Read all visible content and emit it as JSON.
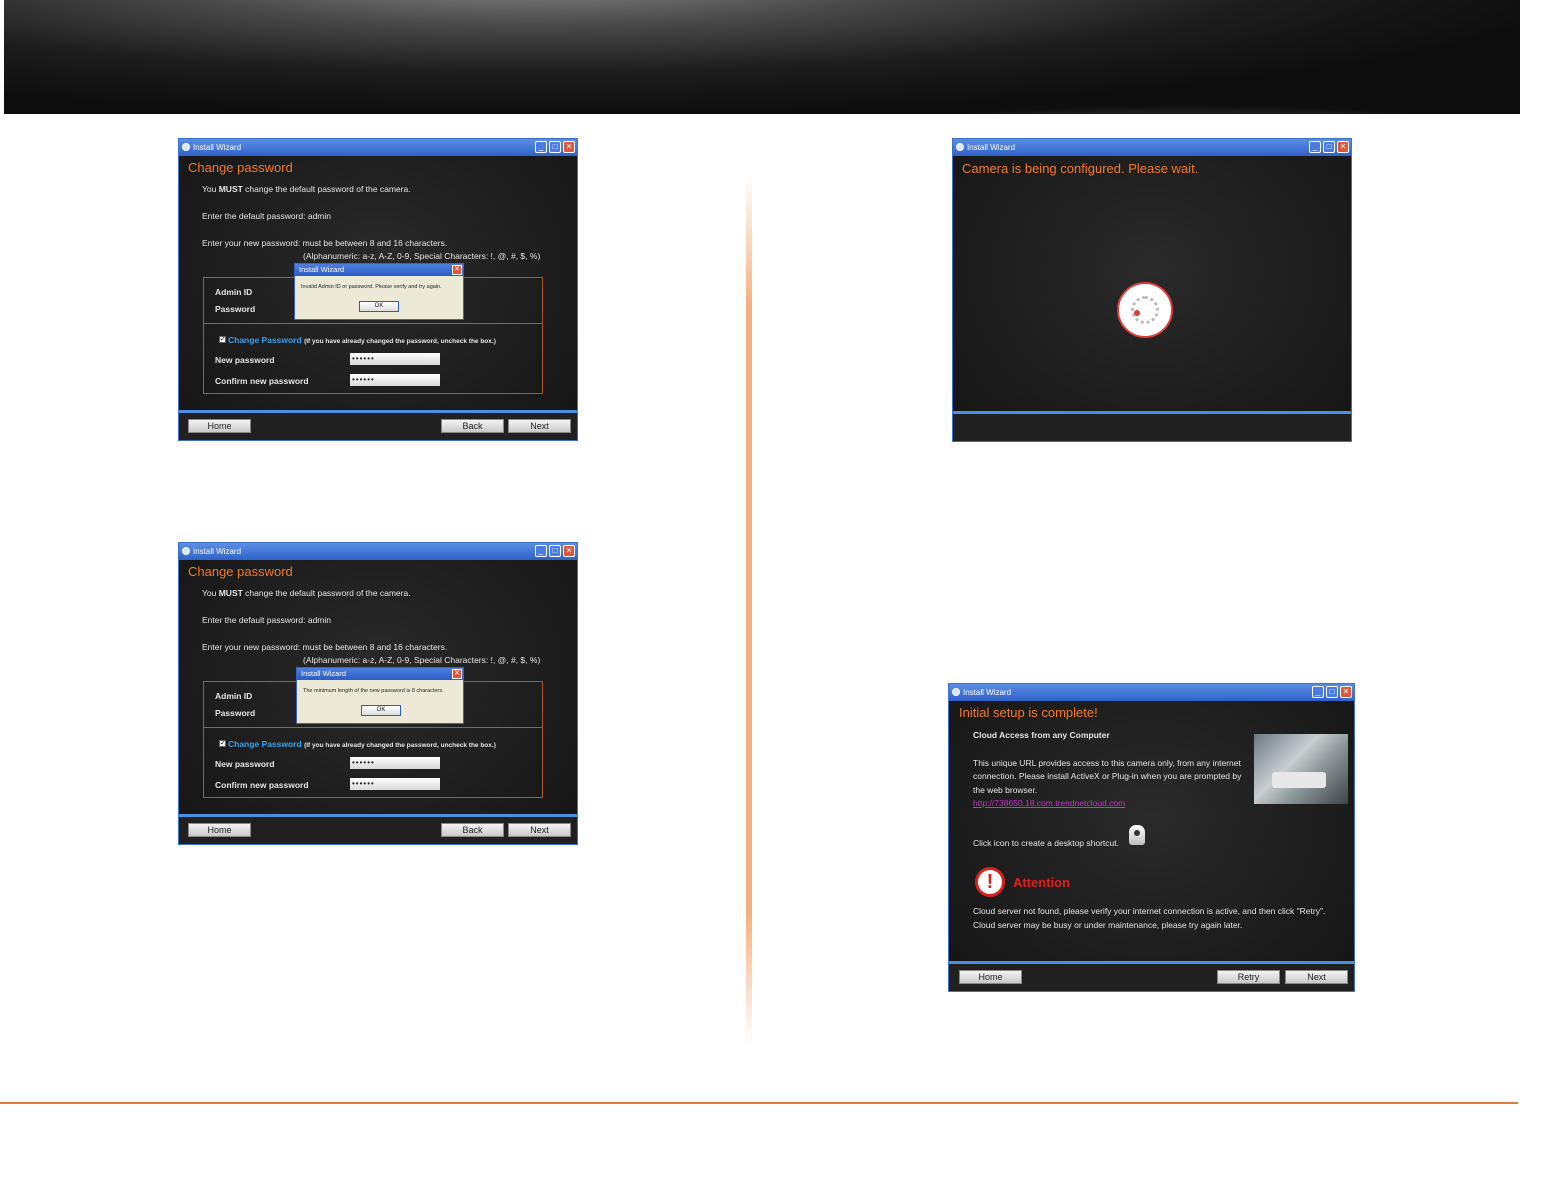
{
  "window1": {
    "title": "Install Wizard",
    "heading": "Change password",
    "must_pre": "You ",
    "must_bold": "MUST",
    "must_post": " change the default password of the camera.",
    "default_pw": "Enter the default password: admin",
    "new_pw_rule": "Enter your new password: must be between 8 and 16 characters.",
    "allowed_chars": "(Alphanumeric: a-z, A-Z, 0-9, Special Characters: !, @, #, $, %)",
    "admin_id_label": "Admin ID",
    "password_label": "Password",
    "change_pw_label": "Change Password",
    "change_pw_note": "(If you have already changed the password, uncheck the box.)",
    "new_password_label": "New password",
    "confirm_label": "Confirm new password",
    "new_password_value": "••••••",
    "confirm_value": "••••••",
    "home": "Home",
    "back": "Back",
    "next": "Next",
    "dialog": {
      "title": "Install Wizard",
      "message": "Invalid Admin ID or password. Please verify and try again.",
      "ok": "OK"
    }
  },
  "window2": {
    "title": "Install Wizard",
    "heading": "Change password",
    "must_pre": "You ",
    "must_bold": "MUST",
    "must_post": " change the default password of the camera.",
    "default_pw": "Enter the default password: admin",
    "new_pw_rule": "Enter your new password: must be between 8 and 16 characters.",
    "allowed_chars": "(Alphanumeric: a-z, A-Z, 0-9, Special Characters: !, @, #, $, %)",
    "admin_id_label": "Admin ID",
    "password_label": "Password",
    "change_pw_label": "Change Password",
    "change_pw_note": "(If you have already changed the password, uncheck the box.)",
    "new_password_label": "New password",
    "confirm_label": "Confirm new password",
    "new_password_value": "••••••",
    "confirm_value": "••••••",
    "home": "Home",
    "back": "Back",
    "next": "Next",
    "dialog": {
      "title": "Install Wizard",
      "message": "The minimum length of the new password is 8 characters.",
      "ok": "OK"
    }
  },
  "window3": {
    "title": "Install Wizard",
    "heading": "Camera is being configured. Please wait."
  },
  "window4": {
    "title": "Install Wizard",
    "heading": "Initial setup is complete!",
    "cloud_heading": "Cloud Access from any Computer",
    "cloud_line1": "This unique URL provides access to this camera only, from any internet",
    "cloud_line2": "connection. Please install ActiveX or Plug-in when you are prompted by",
    "cloud_line3": "the web browser.",
    "cloud_url": "http://738650.18.com.trendnetcloud.com",
    "shortcut_text": "Click icon to create a desktop shortcut.",
    "attention": "Attention",
    "warn_line1": "Cloud server not found, please verify your internet connection is active, and then click \"Retry\".",
    "warn_line2": "Cloud server may be busy or under maintenance, please try again later.",
    "home": "Home",
    "retry": "Retry",
    "next": "Next"
  }
}
